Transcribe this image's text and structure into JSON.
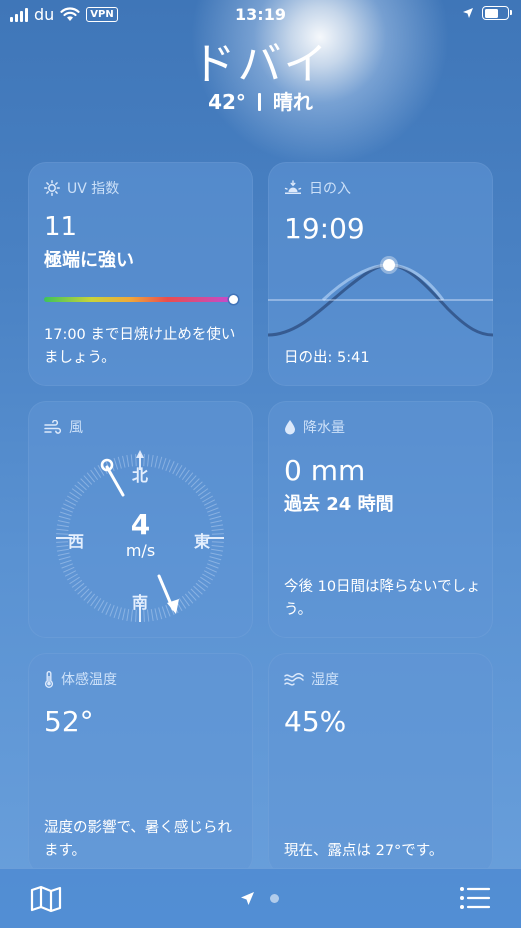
{
  "status_bar": {
    "carrier": "du",
    "vpn": "VPN",
    "time": "13:19"
  },
  "header": {
    "city": "ドバイ",
    "temperature": "42°",
    "condition": "晴れ"
  },
  "uv": {
    "title": "UV 指数",
    "value": "11",
    "level": "極端に強い",
    "index_fraction": 1.0,
    "note": "17:00 まで日焼け止めを使いましょう。"
  },
  "sunset": {
    "title": "日の入",
    "time": "19:09",
    "sunrise": "日の出: 5:41"
  },
  "wind": {
    "title": "風",
    "speed": "4",
    "unit": "m/s",
    "north": "北",
    "south": "南",
    "east": "東",
    "west": "西"
  },
  "precip": {
    "title": "降水量",
    "amount": "0 mm",
    "period": "過去 24 時間",
    "note": "今後 10日間は降らないでしょう。"
  },
  "feels": {
    "title": "体感温度",
    "value": "52°",
    "note": "湿度の影響で、暑く感じられます。"
  },
  "humidity": {
    "title": "湿度",
    "value": "45%",
    "note": "現在、露点は 27°です。"
  },
  "colors": {
    "background": "#4a82c4",
    "card": "#6096d6",
    "uv_gradient": [
      "#3ec35a",
      "#c8d43a",
      "#f0a93a",
      "#ea4d4d",
      "#c24bd4"
    ]
  },
  "icons": [
    "sun-icon",
    "sunset-icon",
    "wind-icon",
    "drop-icon",
    "thermometer-icon",
    "humidity-icon",
    "map-icon",
    "location-arrow-icon",
    "list-icon"
  ]
}
